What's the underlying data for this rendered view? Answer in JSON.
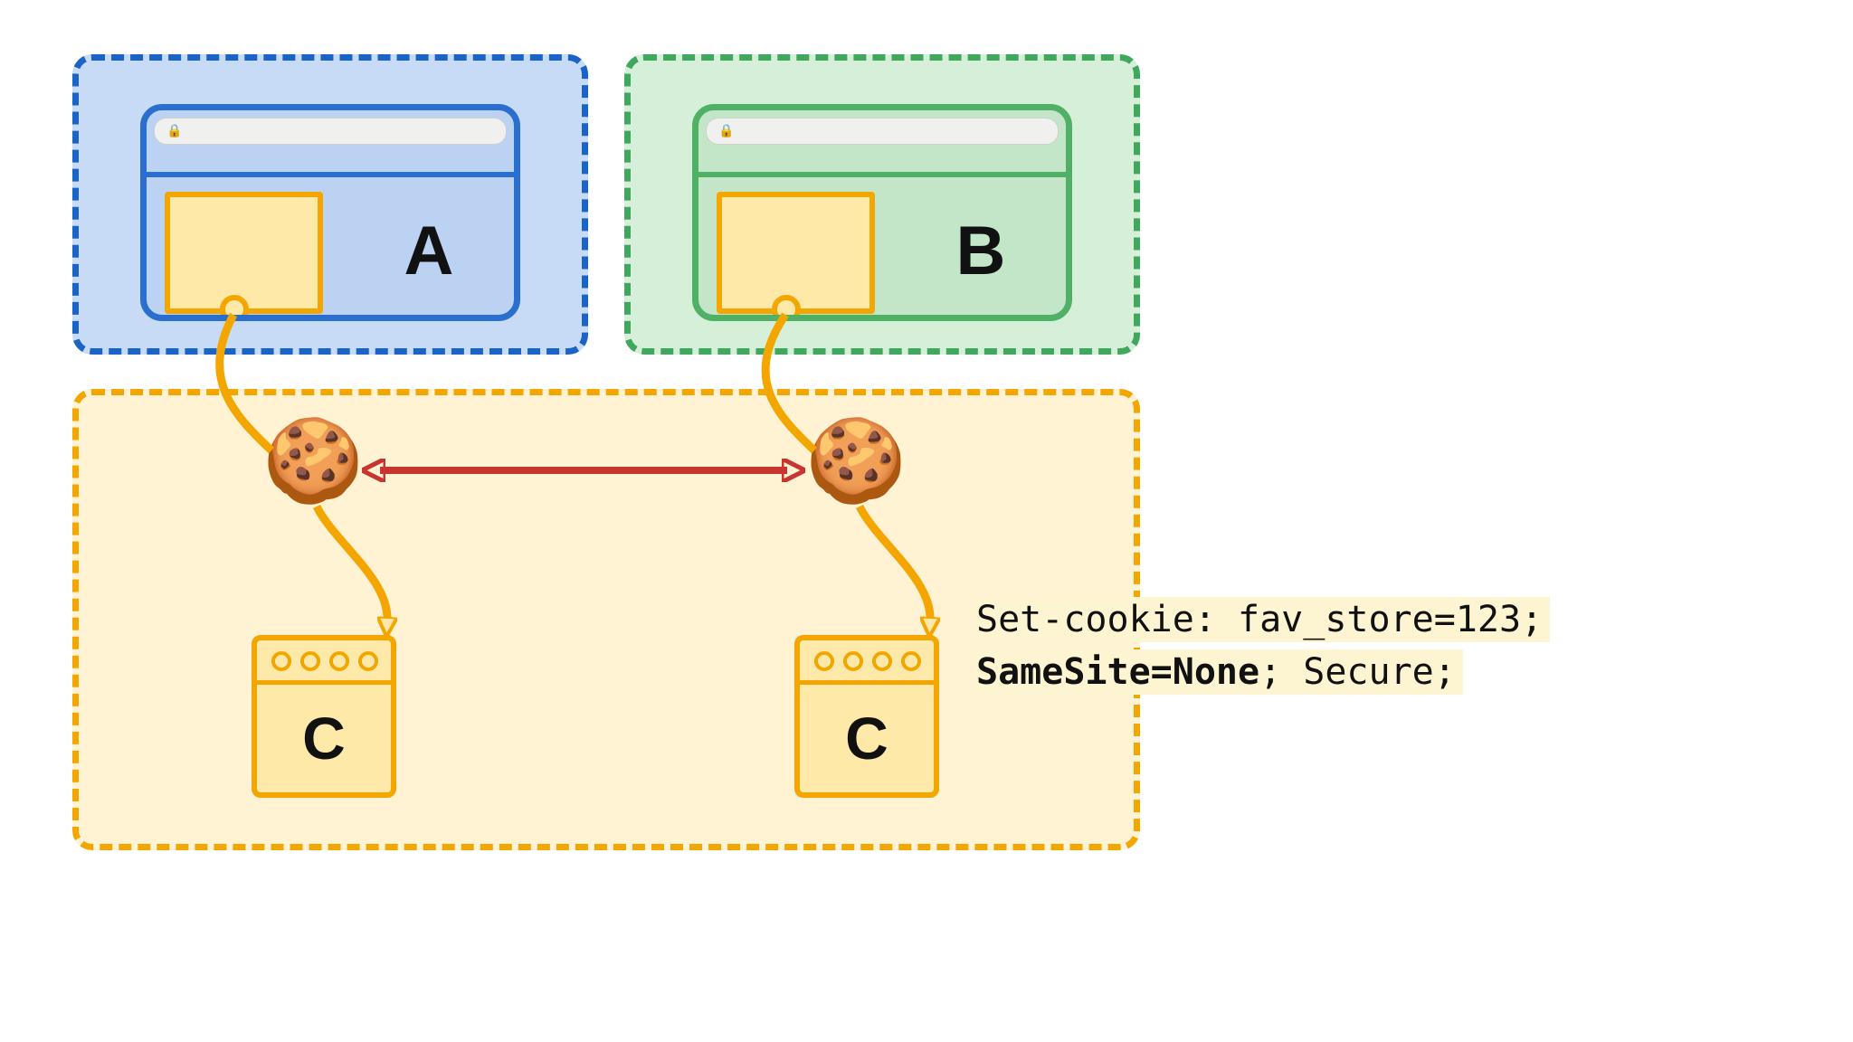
{
  "sites": {
    "a": {
      "label": "A"
    },
    "b": {
      "label": "B"
    },
    "c_left": {
      "label": "C"
    },
    "c_right": {
      "label": "C"
    }
  },
  "code": {
    "line1": "Set-cookie: fav_store=123;",
    "line2_bold": "SameSite=None",
    "line2_rest": "; Secure;"
  },
  "icons": {
    "lock": "🔒",
    "cookie": "🍪"
  },
  "colors": {
    "blue": "#1a63c7",
    "green": "#3fa85d",
    "orange": "#f4a600",
    "red": "#c8342f"
  }
}
